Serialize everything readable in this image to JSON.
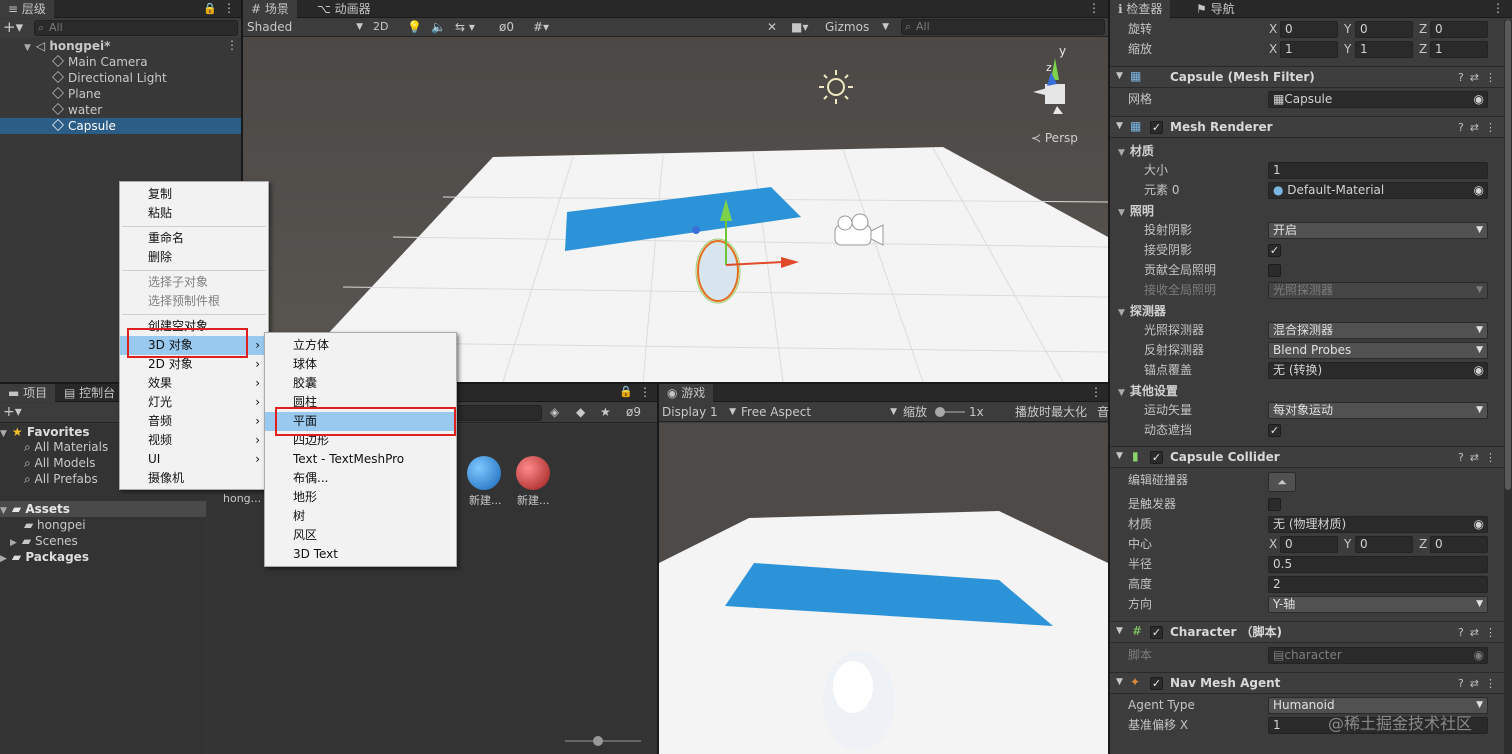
{
  "hierarchy": {
    "tab": "层级",
    "search_placeholder": "All",
    "scene": "hongpei*",
    "items": [
      "Main Camera",
      "Directional Light",
      "Plane",
      "water",
      "Capsule"
    ]
  },
  "scene_view": {
    "tabs": [
      "场景",
      "动画器"
    ],
    "shading": "Shaded",
    "mode_2d": "2D",
    "fx_count": "0",
    "gizmos": "Gizmos",
    "search_placeholder": "All",
    "persp": "Persp",
    "axis_y": "y",
    "axis_z": "z"
  },
  "project": {
    "tabs": [
      "项目",
      "控制台"
    ],
    "favorites": "Favorites",
    "fav_items": [
      "All Materials",
      "All Models",
      "All Prefabs"
    ],
    "assets": "Assets",
    "asset_items": [
      "hongpei",
      "Scenes"
    ],
    "packages": "Packages",
    "hidden_count": "9",
    "thumbs": [
      "hong...",
      "新建...",
      "新建..."
    ]
  },
  "game_view": {
    "tab": "游戏",
    "display": "Display 1",
    "aspect": "Free Aspect",
    "scale_label": "缩放",
    "scale_value": "1x",
    "maximize": "播放时最大化",
    "trailing": "音"
  },
  "context_menu": {
    "items": [
      "复制",
      "粘贴",
      "重命名",
      "删除",
      "选择子对象",
      "选择预制件根",
      "创建空对象",
      "3D 对象",
      "2D 对象",
      "效果",
      "灯光",
      "音频",
      "视频",
      "UI",
      "摄像机"
    ]
  },
  "submenu": {
    "items": [
      "立方体",
      "球体",
      "胶囊",
      "圆柱",
      "平面",
      "四边形",
      "Text - TextMeshPro",
      "布偶...",
      "地形",
      "树",
      "风区",
      "3D Text"
    ]
  },
  "inspector": {
    "tabs": [
      "检查器",
      "导航"
    ],
    "rotation_label": "旋转",
    "rotation": {
      "x": "0",
      "y": "0",
      "z": "0"
    },
    "scale_label": "缩放",
    "scale": {
      "x": "1",
      "y": "1",
      "z": "1"
    },
    "mesh_filter": {
      "title": "Capsule (Mesh Filter)",
      "mesh_label": "网格",
      "mesh": "Capsule"
    },
    "mesh_renderer": {
      "title": "Mesh Renderer",
      "materials": "材质",
      "size_label": "大小",
      "size": "1",
      "elem_label": "元素 0",
      "elem": "Default-Material",
      "lighting": "照明",
      "cast_label": "投射阴影",
      "cast": "开启",
      "receive_label": "接受阴影",
      "contribute_label": "贡献全局照明",
      "receive_gi_label": "接收全局照明",
      "receive_gi": "光照探测器",
      "probes": "探测器",
      "light_probe_label": "光照探测器",
      "light_probe": "混合探测器",
      "refl_probe_label": "反射探测器",
      "refl_probe": "Blend Probes",
      "anchor_label": "锚点覆盖",
      "anchor": "无 (转换)",
      "other": "其他设置",
      "motion_label": "运动矢量",
      "motion": "每对象运动",
      "dyn_occ_label": "动态遮挡"
    },
    "collider": {
      "title": "Capsule Collider",
      "edit_label": "编辑碰撞器",
      "trigger_label": "是触发器",
      "material_label": "材质",
      "material": "无 (物理材质)",
      "center_label": "中心",
      "center": {
        "x": "0",
        "y": "0",
        "z": "0"
      },
      "radius_label": "半径",
      "radius": "0.5",
      "height_label": "高度",
      "height": "2",
      "dir_label": "方向",
      "dir": "Y-轴"
    },
    "character": {
      "title": "Character （脚本)",
      "script_label": "脚本",
      "script": "character"
    },
    "nav": {
      "title": "Nav Mesh Agent",
      "type_label": "Agent Type",
      "type": "Humanoid",
      "offset_label": "基准偏移 X",
      "offset": "1"
    }
  },
  "watermark": "@稀土掘金技术社区",
  "colors": {
    "selection": "#2c5d87",
    "menu_highlight": "#99c9ef",
    "red_box": "#e02020",
    "water": "#2c93d8"
  }
}
